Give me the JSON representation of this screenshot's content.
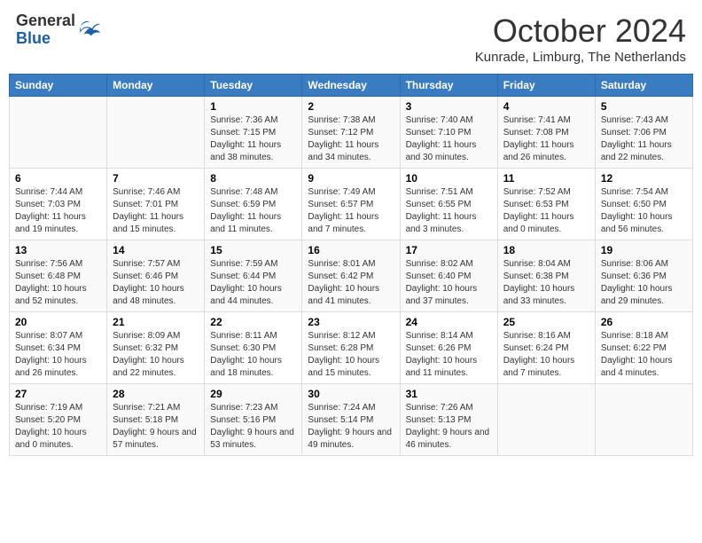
{
  "header": {
    "logo": {
      "general": "General",
      "blue": "Blue"
    },
    "title": "October 2024",
    "location": "Kunrade, Limburg, The Netherlands"
  },
  "weekdays": [
    "Sunday",
    "Monday",
    "Tuesday",
    "Wednesday",
    "Thursday",
    "Friday",
    "Saturday"
  ],
  "weeks": [
    [
      {
        "day": "",
        "info": ""
      },
      {
        "day": "",
        "info": ""
      },
      {
        "day": "1",
        "info": "Sunrise: 7:36 AM\nSunset: 7:15 PM\nDaylight: 11 hours and 38 minutes."
      },
      {
        "day": "2",
        "info": "Sunrise: 7:38 AM\nSunset: 7:12 PM\nDaylight: 11 hours and 34 minutes."
      },
      {
        "day": "3",
        "info": "Sunrise: 7:40 AM\nSunset: 7:10 PM\nDaylight: 11 hours and 30 minutes."
      },
      {
        "day": "4",
        "info": "Sunrise: 7:41 AM\nSunset: 7:08 PM\nDaylight: 11 hours and 26 minutes."
      },
      {
        "day": "5",
        "info": "Sunrise: 7:43 AM\nSunset: 7:06 PM\nDaylight: 11 hours and 22 minutes."
      }
    ],
    [
      {
        "day": "6",
        "info": "Sunrise: 7:44 AM\nSunset: 7:03 PM\nDaylight: 11 hours and 19 minutes."
      },
      {
        "day": "7",
        "info": "Sunrise: 7:46 AM\nSunset: 7:01 PM\nDaylight: 11 hours and 15 minutes."
      },
      {
        "day": "8",
        "info": "Sunrise: 7:48 AM\nSunset: 6:59 PM\nDaylight: 11 hours and 11 minutes."
      },
      {
        "day": "9",
        "info": "Sunrise: 7:49 AM\nSunset: 6:57 PM\nDaylight: 11 hours and 7 minutes."
      },
      {
        "day": "10",
        "info": "Sunrise: 7:51 AM\nSunset: 6:55 PM\nDaylight: 11 hours and 3 minutes."
      },
      {
        "day": "11",
        "info": "Sunrise: 7:52 AM\nSunset: 6:53 PM\nDaylight: 11 hours and 0 minutes."
      },
      {
        "day": "12",
        "info": "Sunrise: 7:54 AM\nSunset: 6:50 PM\nDaylight: 10 hours and 56 minutes."
      }
    ],
    [
      {
        "day": "13",
        "info": "Sunrise: 7:56 AM\nSunset: 6:48 PM\nDaylight: 10 hours and 52 minutes."
      },
      {
        "day": "14",
        "info": "Sunrise: 7:57 AM\nSunset: 6:46 PM\nDaylight: 10 hours and 48 minutes."
      },
      {
        "day": "15",
        "info": "Sunrise: 7:59 AM\nSunset: 6:44 PM\nDaylight: 10 hours and 44 minutes."
      },
      {
        "day": "16",
        "info": "Sunrise: 8:01 AM\nSunset: 6:42 PM\nDaylight: 10 hours and 41 minutes."
      },
      {
        "day": "17",
        "info": "Sunrise: 8:02 AM\nSunset: 6:40 PM\nDaylight: 10 hours and 37 minutes."
      },
      {
        "day": "18",
        "info": "Sunrise: 8:04 AM\nSunset: 6:38 PM\nDaylight: 10 hours and 33 minutes."
      },
      {
        "day": "19",
        "info": "Sunrise: 8:06 AM\nSunset: 6:36 PM\nDaylight: 10 hours and 29 minutes."
      }
    ],
    [
      {
        "day": "20",
        "info": "Sunrise: 8:07 AM\nSunset: 6:34 PM\nDaylight: 10 hours and 26 minutes."
      },
      {
        "day": "21",
        "info": "Sunrise: 8:09 AM\nSunset: 6:32 PM\nDaylight: 10 hours and 22 minutes."
      },
      {
        "day": "22",
        "info": "Sunrise: 8:11 AM\nSunset: 6:30 PM\nDaylight: 10 hours and 18 minutes."
      },
      {
        "day": "23",
        "info": "Sunrise: 8:12 AM\nSunset: 6:28 PM\nDaylight: 10 hours and 15 minutes."
      },
      {
        "day": "24",
        "info": "Sunrise: 8:14 AM\nSunset: 6:26 PM\nDaylight: 10 hours and 11 minutes."
      },
      {
        "day": "25",
        "info": "Sunrise: 8:16 AM\nSunset: 6:24 PM\nDaylight: 10 hours and 7 minutes."
      },
      {
        "day": "26",
        "info": "Sunrise: 8:18 AM\nSunset: 6:22 PM\nDaylight: 10 hours and 4 minutes."
      }
    ],
    [
      {
        "day": "27",
        "info": "Sunrise: 7:19 AM\nSunset: 5:20 PM\nDaylight: 10 hours and 0 minutes."
      },
      {
        "day": "28",
        "info": "Sunrise: 7:21 AM\nSunset: 5:18 PM\nDaylight: 9 hours and 57 minutes."
      },
      {
        "day": "29",
        "info": "Sunrise: 7:23 AM\nSunset: 5:16 PM\nDaylight: 9 hours and 53 minutes."
      },
      {
        "day": "30",
        "info": "Sunrise: 7:24 AM\nSunset: 5:14 PM\nDaylight: 9 hours and 49 minutes."
      },
      {
        "day": "31",
        "info": "Sunrise: 7:26 AM\nSunset: 5:13 PM\nDaylight: 9 hours and 46 minutes."
      },
      {
        "day": "",
        "info": ""
      },
      {
        "day": "",
        "info": ""
      }
    ]
  ]
}
